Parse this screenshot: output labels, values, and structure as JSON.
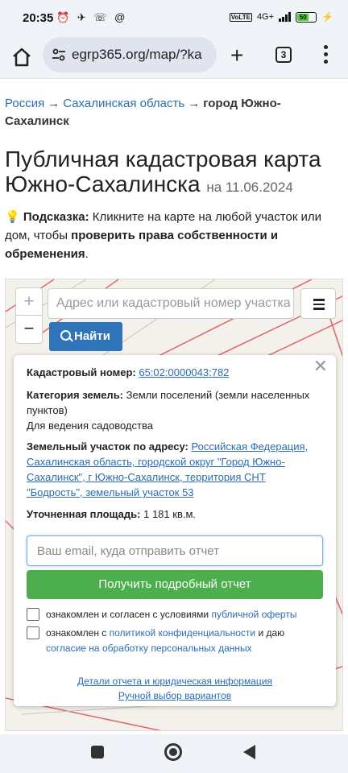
{
  "status_bar": {
    "time": "20:35",
    "left_icons": "⏰ ✈ ☏ @",
    "network": "4G+",
    "lte": "VoLTE",
    "battery": "50"
  },
  "browser": {
    "url": "egrp365.org/map/?ka",
    "tab_count": "3"
  },
  "breadcrumb": {
    "items": [
      "Россия",
      "Сахалинская область"
    ],
    "separator": "→",
    "current": "город Южно-Сахалинск"
  },
  "page": {
    "title": "Публичная кадастровая карта Южно-Сахалинска",
    "date": "на 11.06.2024",
    "hint_icon": "💡",
    "hint_label": "Подсказка:",
    "hint_text_1": "Кликните на карте на любой участок или дом, чтобы",
    "hint_bold": "проверить права собственности и обременения",
    "hint_end": "."
  },
  "map": {
    "zoom_in": "+",
    "zoom_out": "−",
    "search_placeholder": "Адрес или кадастровый номер участка",
    "find_label": "Найти"
  },
  "popup": {
    "close": "✕",
    "cad_label": "Кадастровый номер:",
    "cad_value": "65:02:0000043:782",
    "cat_label": "Категория земель:",
    "cat_value": "Земли поселений (земли населенных пунктов)",
    "use_value": "Для ведения садоводства",
    "addr_label": "Земельный участок по адресу:",
    "addr_value": "Российская Федерация, Сахалинская область, городской округ \"Город Южно-Сахалинск\", г Южно-Сахалинск, территория СНТ \"Бодрость\", земельный участок 53",
    "area_label": "Уточненная площадь:",
    "area_value": "1 181 кв.м.",
    "email_placeholder": "Ваш email, куда отправить отчет",
    "report_button": "Получить подробный отчет",
    "agree1_text": "ознакомлен и согласен с условиями",
    "agree1_link": "публичной оферты",
    "agree2_text_a": "ознакомлен с",
    "agree2_link_a": "политикой конфиденциальности",
    "agree2_text_b": "и даю",
    "agree2_link_b": "согласие на обработку персональных данных",
    "details_link": "Детали отчета и юридическая информация",
    "manual_link": "Ручной выбор вариантов"
  },
  "colors": {
    "link": "#2a6db3",
    "primary_button": "#2f73b8",
    "success_button": "#4cae4c",
    "map_parcel_line": "#e06666"
  }
}
